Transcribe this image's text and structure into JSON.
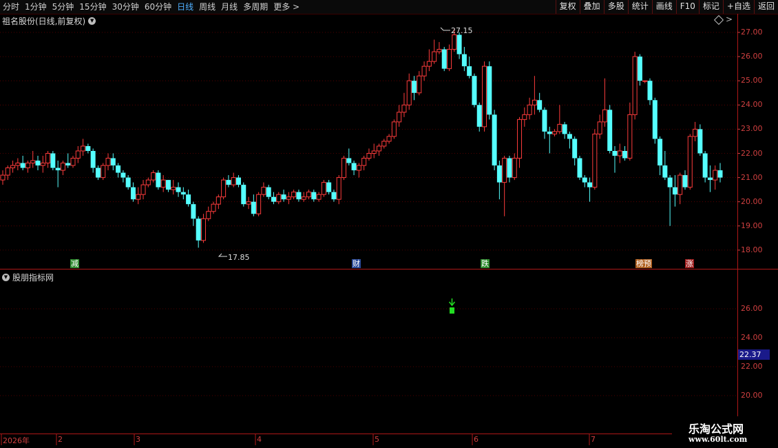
{
  "toolbar": {
    "left_items": [
      "分时",
      "1分钟",
      "5分钟",
      "15分钟",
      "30分钟",
      "60分钟",
      "日线",
      "周线",
      "月线",
      "多周期",
      "更多 >"
    ],
    "active_item": "日线",
    "right_items": [
      "复权",
      "叠加",
      "多股",
      "统计",
      "画线",
      "F10",
      "标记",
      "+自选",
      "返回"
    ]
  },
  "main_panel": {
    "title": "祖名股份(日线,前复权)",
    "y_ticks": [
      "27.00",
      "26.00",
      "25.00",
      "24.00",
      "23.00",
      "22.00",
      "21.00",
      "20.00",
      "19.00",
      "18.00"
    ],
    "high_label": "27.15",
    "low_label": "17.85",
    "event_tags": [
      {
        "text": "减",
        "color": "#2e8b2e"
      },
      {
        "text": "财",
        "color": "#2a4a9a"
      },
      {
        "text": "跌",
        "color": "#2e8b2e"
      },
      {
        "text": "榜预",
        "color": "#b06020"
      },
      {
        "text": "涨",
        "color": "#a02020"
      }
    ]
  },
  "sub_panel": {
    "title": "股朋指标网",
    "y_ticks": [
      "26.00",
      "24.00",
      "22.00",
      "20.00"
    ],
    "current_price": "22.37"
  },
  "date_axis": [
    "2026年",
    "2",
    "3",
    "4",
    "5",
    "6",
    "7"
  ],
  "watermark": {
    "line1": "乐淘公式网",
    "line2": "www.60lt.com"
  },
  "chart_data": {
    "type": "candlestick",
    "ylim": [
      17.7,
      27.35
    ],
    "up_color": "#ff3c3c",
    "down_color": "#55ffff",
    "candles": [
      [
        20.9,
        21.3,
        20.7,
        21.1
      ],
      [
        21.1,
        21.5,
        20.9,
        21.4
      ],
      [
        21.4,
        21.7,
        21.2,
        21.5
      ],
      [
        21.5,
        21.8,
        21.3,
        21.6
      ],
      [
        21.6,
        21.9,
        21.3,
        21.4
      ],
      [
        21.4,
        21.7,
        21.2,
        21.6
      ],
      [
        21.6,
        22.1,
        21.4,
        21.7
      ],
      [
        21.7,
        21.9,
        21.3,
        21.5
      ],
      [
        21.5,
        21.9,
        21.2,
        21.6
      ],
      [
        21.6,
        22.1,
        21.4,
        22.0
      ],
      [
        22.0,
        22.1,
        21.3,
        21.4
      ],
      [
        21.4,
        21.7,
        20.6,
        21.3
      ],
      [
        21.3,
        21.7,
        21.1,
        21.6
      ],
      [
        21.6,
        22.0,
        21.4,
        21.5
      ],
      [
        21.5,
        21.9,
        21.4,
        21.8
      ],
      [
        21.8,
        22.3,
        21.6,
        22.1
      ],
      [
        22.1,
        22.6,
        21.9,
        22.3
      ],
      [
        22.3,
        22.4,
        22.0,
        22.1
      ],
      [
        22.1,
        22.2,
        21.2,
        21.4
      ],
      [
        21.4,
        21.5,
        20.9,
        21.0
      ],
      [
        21.0,
        21.6,
        20.9,
        21.5
      ],
      [
        21.5,
        22.0,
        21.3,
        21.8
      ],
      [
        21.8,
        22.0,
        21.3,
        21.5
      ],
      [
        21.5,
        21.6,
        21.0,
        21.2
      ],
      [
        21.2,
        21.3,
        20.8,
        21.0
      ],
      [
        21.0,
        21.1,
        20.5,
        20.6
      ],
      [
        20.6,
        20.8,
        20.0,
        20.1
      ],
      [
        20.1,
        20.6,
        19.9,
        20.3
      ],
      [
        20.3,
        20.9,
        20.1,
        20.7
      ],
      [
        20.7,
        21.0,
        20.6,
        20.9
      ],
      [
        20.9,
        21.3,
        20.8,
        21.2
      ],
      [
        21.2,
        21.3,
        20.5,
        20.6
      ],
      [
        20.6,
        21.1,
        20.4,
        20.9
      ],
      [
        20.9,
        20.9,
        20.4,
        20.5
      ],
      [
        20.5,
        20.9,
        20.3,
        20.6
      ],
      [
        20.6,
        20.8,
        20.2,
        20.4
      ],
      [
        20.4,
        20.6,
        20.1,
        20.3
      ],
      [
        20.3,
        20.5,
        19.8,
        19.9
      ],
      [
        19.9,
        20.0,
        19.0,
        19.3
      ],
      [
        19.3,
        19.4,
        18.1,
        18.4
      ],
      [
        18.4,
        19.5,
        18.3,
        19.3
      ],
      [
        19.3,
        19.8,
        19.2,
        19.6
      ],
      [
        19.6,
        20.0,
        19.5,
        19.9
      ],
      [
        19.9,
        20.3,
        19.7,
        20.2
      ],
      [
        20.2,
        21.0,
        20.1,
        20.9
      ],
      [
        20.9,
        21.1,
        20.6,
        20.7
      ],
      [
        20.7,
        21.2,
        20.6,
        21.0
      ],
      [
        21.0,
        21.1,
        20.6,
        20.7
      ],
      [
        20.7,
        20.8,
        19.8,
        19.9
      ],
      [
        19.9,
        20.2,
        19.7,
        20.0
      ],
      [
        20.0,
        20.3,
        19.4,
        19.5
      ],
      [
        19.5,
        20.4,
        19.4,
        20.3
      ],
      [
        20.3,
        20.8,
        20.2,
        20.6
      ],
      [
        20.6,
        20.7,
        20.1,
        20.2
      ],
      [
        20.2,
        20.4,
        19.9,
        20.0
      ],
      [
        20.0,
        20.4,
        19.9,
        20.3
      ],
      [
        20.3,
        20.5,
        20.0,
        20.1
      ],
      [
        20.1,
        20.4,
        19.9,
        20.2
      ],
      [
        20.2,
        20.5,
        20.1,
        20.4
      ],
      [
        20.4,
        20.5,
        20.0,
        20.1
      ],
      [
        20.1,
        20.4,
        20.0,
        20.2
      ],
      [
        20.2,
        20.5,
        20.1,
        20.4
      ],
      [
        20.4,
        20.5,
        20.0,
        20.1
      ],
      [
        20.1,
        20.4,
        20.0,
        20.3
      ],
      [
        20.3,
        20.9,
        20.2,
        20.8
      ],
      [
        20.8,
        20.9,
        20.3,
        20.4
      ],
      [
        20.4,
        20.5,
        20.0,
        20.1
      ],
      [
        20.1,
        21.1,
        19.9,
        21.0
      ],
      [
        21.0,
        21.9,
        20.9,
        21.8
      ],
      [
        21.8,
        22.2,
        21.5,
        21.6
      ],
      [
        21.6,
        21.7,
        21.1,
        21.3
      ],
      [
        21.3,
        21.6,
        21.0,
        21.5
      ],
      [
        21.5,
        21.9,
        21.3,
        21.8
      ],
      [
        21.8,
        22.2,
        21.7,
        22.0
      ],
      [
        22.0,
        22.4,
        21.8,
        22.1
      ],
      [
        22.1,
        22.4,
        21.9,
        22.3
      ],
      [
        22.3,
        22.6,
        22.2,
        22.5
      ],
      [
        22.5,
        22.8,
        22.4,
        22.7
      ],
      [
        22.7,
        23.4,
        22.6,
        23.3
      ],
      [
        23.3,
        24.0,
        23.1,
        23.7
      ],
      [
        23.7,
        24.5,
        23.5,
        24.0
      ],
      [
        24.0,
        25.3,
        23.8,
        25.0
      ],
      [
        25.0,
        25.2,
        24.2,
        24.5
      ],
      [
        24.5,
        25.4,
        24.4,
        25.2
      ],
      [
        25.2,
        25.8,
        25.0,
        25.6
      ],
      [
        25.6,
        26.3,
        25.4,
        25.8
      ],
      [
        25.8,
        26.7,
        25.7,
        26.2
      ],
      [
        26.2,
        26.6,
        26.1,
        26.3
      ],
      [
        26.3,
        26.4,
        25.4,
        25.5
      ],
      [
        25.5,
        26.5,
        25.4,
        26.3
      ],
      [
        26.3,
        27.15,
        26.2,
        26.9
      ],
      [
        26.9,
        27.0,
        25.9,
        26.1
      ],
      [
        26.1,
        26.4,
        25.4,
        25.6
      ],
      [
        25.6,
        26.0,
        25.1,
        25.2
      ],
      [
        25.2,
        25.3,
        23.9,
        24.0
      ],
      [
        24.0,
        24.1,
        22.9,
        23.1
      ],
      [
        23.1,
        25.8,
        22.9,
        25.6
      ],
      [
        25.6,
        25.8,
        23.4,
        23.6
      ],
      [
        23.6,
        23.8,
        21.3,
        21.5
      ],
      [
        21.5,
        21.7,
        20.1,
        20.8
      ],
      [
        20.8,
        21.9,
        19.4,
        21.8
      ],
      [
        21.8,
        21.9,
        20.8,
        21.0
      ],
      [
        21.0,
        22.0,
        20.9,
        21.8
      ],
      [
        21.8,
        23.5,
        21.4,
        23.4
      ],
      [
        23.4,
        23.9,
        23.1,
        23.6
      ],
      [
        23.6,
        24.3,
        23.4,
        24.0
      ],
      [
        24.0,
        25.2,
        23.6,
        24.2
      ],
      [
        24.2,
        24.5,
        23.7,
        23.8
      ],
      [
        23.8,
        23.9,
        22.6,
        22.9
      ],
      [
        22.9,
        23.1,
        22.0,
        22.8
      ],
      [
        22.8,
        23.0,
        22.7,
        22.9
      ],
      [
        22.9,
        24.0,
        22.8,
        23.2
      ],
      [
        23.2,
        23.3,
        22.6,
        22.8
      ],
      [
        22.8,
        22.9,
        22.2,
        22.6
      ],
      [
        22.6,
        22.7,
        21.5,
        21.8
      ],
      [
        21.8,
        21.9,
        20.9,
        21.0
      ],
      [
        21.0,
        21.1,
        20.6,
        20.8
      ],
      [
        20.8,
        21.0,
        20.0,
        20.6
      ],
      [
        20.6,
        23.0,
        20.5,
        22.8
      ],
      [
        22.8,
        23.6,
        22.6,
        23.3
      ],
      [
        23.3,
        25.1,
        23.1,
        23.8
      ],
      [
        23.8,
        24.0,
        22.0,
        22.1
      ],
      [
        22.1,
        22.3,
        21.2,
        21.9
      ],
      [
        21.9,
        22.4,
        21.6,
        22.1
      ],
      [
        22.1,
        22.3,
        21.7,
        21.8
      ],
      [
        21.8,
        24.1,
        21.7,
        23.6
      ],
      [
        23.6,
        26.2,
        23.4,
        26.0
      ],
      [
        26.0,
        26.1,
        24.8,
        25.0
      ],
      [
        25.0,
        25.0,
        24.9,
        25.0
      ],
      [
        25.0,
        25.1,
        24.0,
        24.2
      ],
      [
        24.2,
        24.3,
        22.4,
        22.6
      ],
      [
        22.6,
        22.7,
        21.1,
        21.5
      ],
      [
        21.5,
        22.1,
        20.9,
        21.0
      ],
      [
        21.0,
        21.1,
        19.0,
        20.6
      ],
      [
        20.6,
        21.1,
        19.8,
        20.3
      ],
      [
        20.3,
        21.2,
        19.9,
        21.1
      ],
      [
        21.1,
        21.3,
        20.5,
        20.6
      ],
      [
        20.6,
        22.8,
        20.5,
        22.7
      ],
      [
        22.7,
        23.3,
        22.5,
        23.0
      ],
      [
        23.0,
        23.2,
        21.9,
        22.0
      ],
      [
        22.0,
        22.1,
        20.8,
        21.0
      ],
      [
        21.0,
        21.5,
        20.4,
        20.9
      ],
      [
        20.9,
        21.5,
        20.5,
        21.3
      ],
      [
        21.3,
        21.6,
        20.8,
        21.0
      ]
    ]
  }
}
